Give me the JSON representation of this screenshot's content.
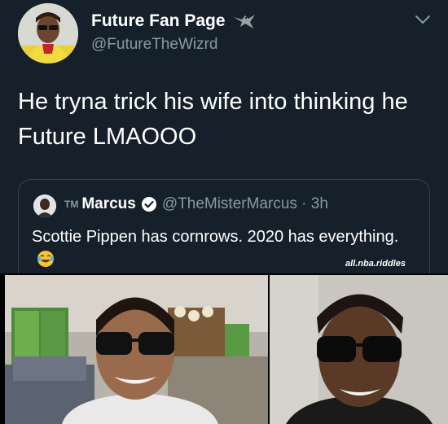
{
  "tweet": {
    "display_name": "Future Fan Page",
    "handle": "@FutureTheWizrd",
    "text": "He tryna trick his wife into thinking he Future LMAOOO",
    "icons": {
      "badge": "hawk-icon",
      "menu": "chevron-down-icon"
    }
  },
  "quote": {
    "prefix": "TM",
    "name": "Marcus",
    "handle_time": "@TheMisterMarcus · 3h",
    "text": "Scottie Pippen has cornrows. 2020 has everything.",
    "icons": {
      "verified": "verified-icon",
      "emoji": "laughing-emoji-icon"
    }
  },
  "watermark": "all.nba.riddles",
  "colors": {
    "background": "#15202b",
    "secondary_text": "#8899a6",
    "border": "#38444d"
  }
}
